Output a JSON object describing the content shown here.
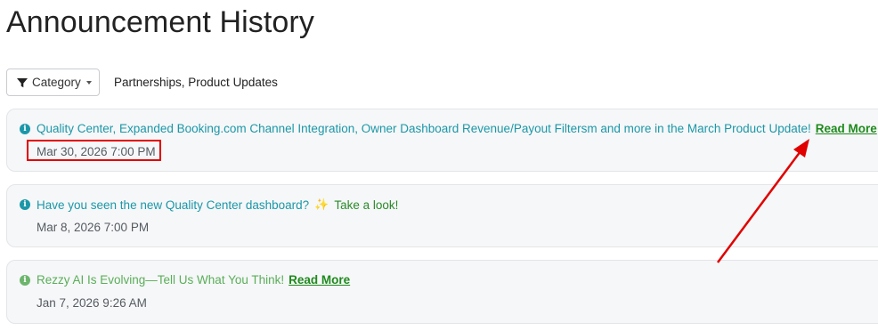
{
  "page": {
    "title": "Announcement History"
  },
  "filter": {
    "button_label": "Category",
    "selected_text": "Partnerships, Product Updates"
  },
  "announcements": [
    {
      "message": "Quality Center, Expanded Booking.com Channel Integration, Owner Dashboard Revenue/Payout Filtersm and more in the March Product Update!",
      "link_label": "Read More",
      "date": "Mar 30, 2026 7:00 PM"
    },
    {
      "message": "Have you seen the new Quality Center dashboard?",
      "emoji": "✨",
      "link_label": "Take a look!",
      "date": "Mar 8, 2026 7:00 PM"
    },
    {
      "message": "Rezzy AI Is Evolving—Tell Us What You Think!",
      "link_label": "Read More",
      "date": "Jan 7, 2026 9:26 AM"
    }
  ],
  "colors": {
    "info_teal": "#1b97a8",
    "info_green": "#6cb56c",
    "link_green": "#1e8a1e",
    "annotation_red": "#e00000"
  },
  "icons": {
    "filter": "funnel-icon",
    "info": "info-circle-icon",
    "external_link": "external-link-icon"
  }
}
